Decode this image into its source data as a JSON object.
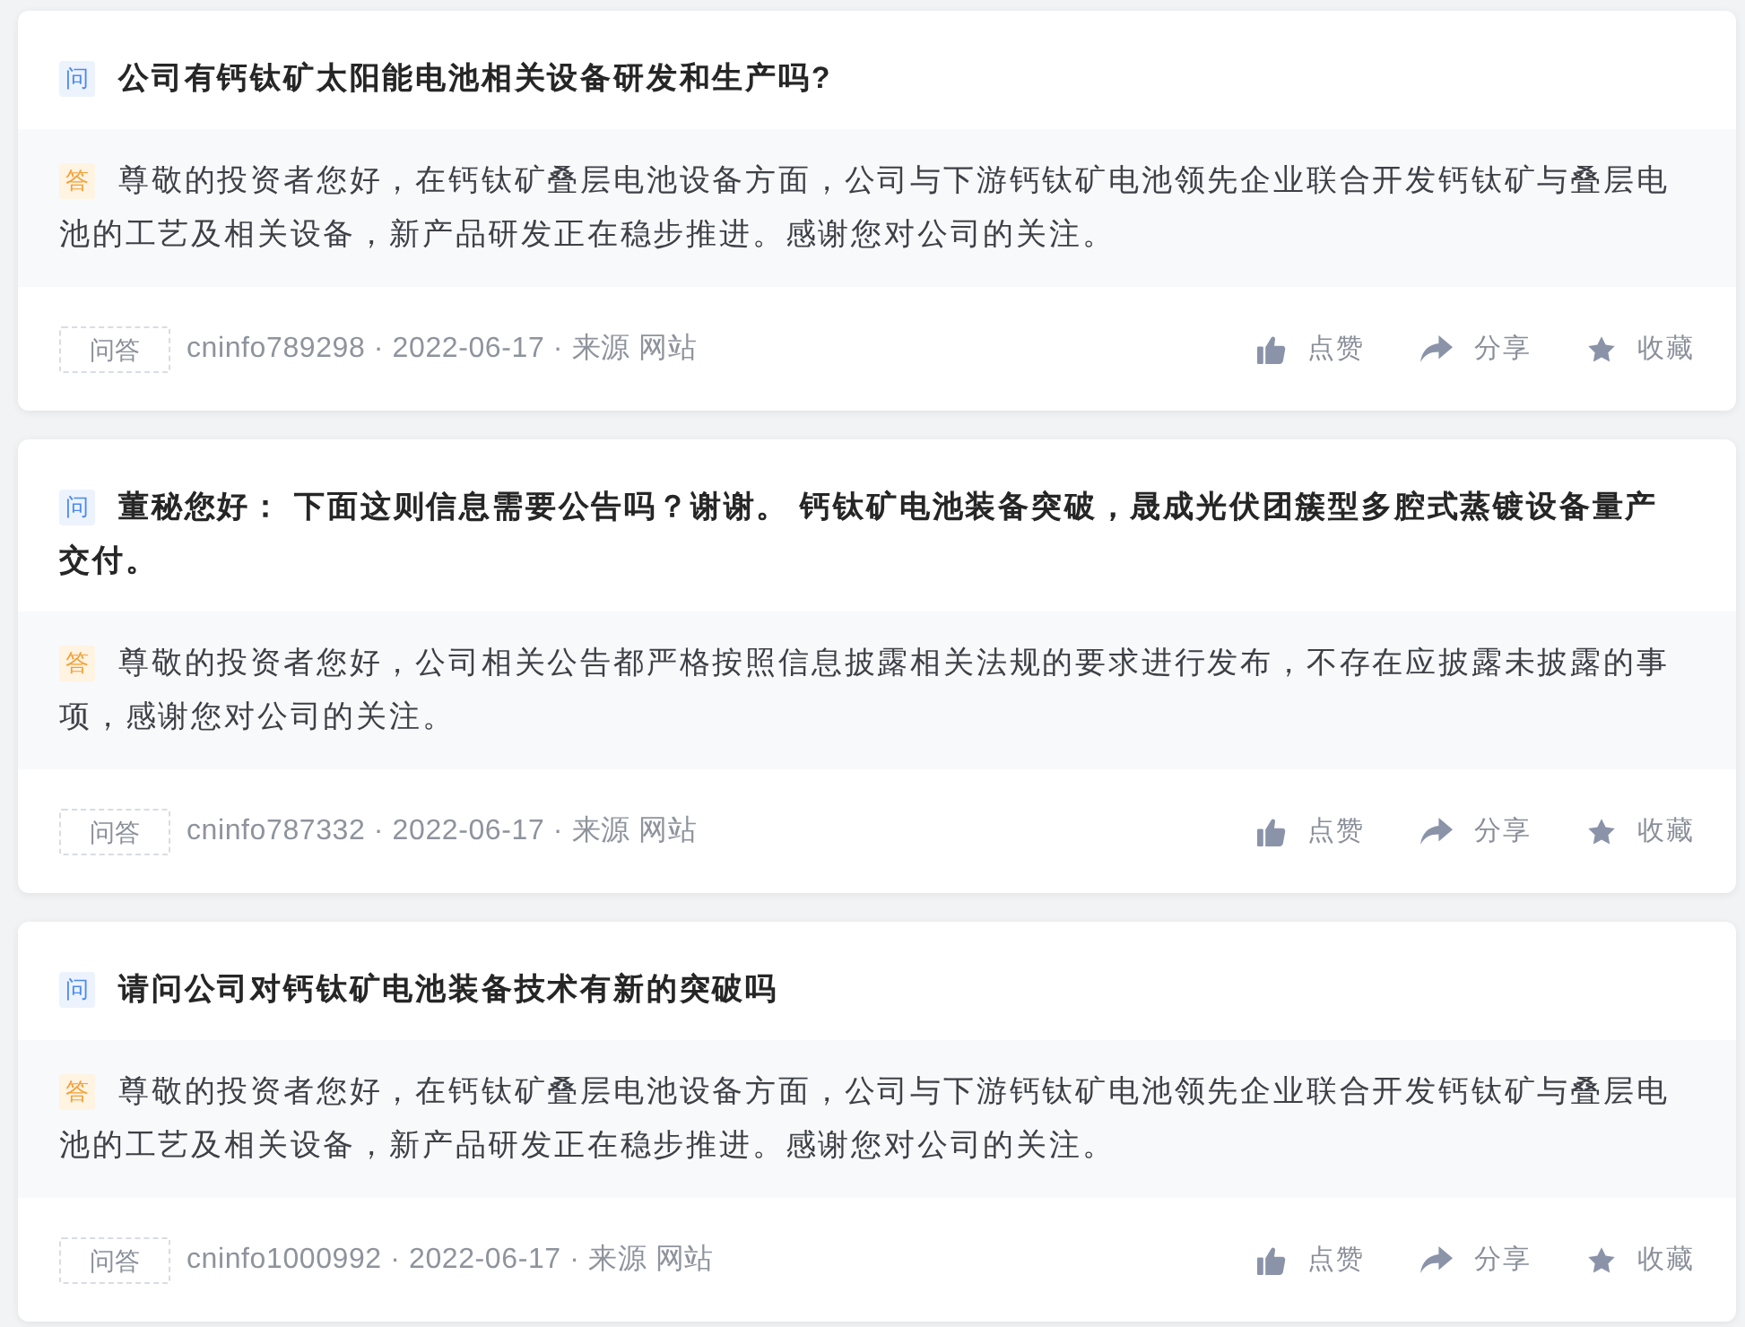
{
  "cards": [
    {
      "question": {
        "badge": "问",
        "text": "公司有钙钛矿太阳能电池相关设备研发和生产吗?"
      },
      "answer": {
        "badge": "答",
        "text": "尊敬的投资者您好，在钙钛矿叠层电池设备方面，公司与下游钙钛矿电池领先企业联合开发钙钛矿与叠层电池的工艺及相关设备，新产品研发正在稳步推进。感谢您对公司的关注。"
      },
      "tag": "问答",
      "meta": "cninfo789298 · 2022-06-17 · 来源 网站",
      "actions": [
        {
          "kind": "like",
          "label": "点赞"
        },
        {
          "kind": "share",
          "label": "分享"
        },
        {
          "kind": "favorite",
          "label": "收藏"
        }
      ]
    },
    {
      "question": {
        "badge": "问",
        "text": "董秘您好： 下面这则信息需要公告吗？谢谢。 钙钛矿电池装备突破，晟成光伏团簇型多腔式蒸镀设备量产交付。"
      },
      "answer": {
        "badge": "答",
        "text": "尊敬的投资者您好，公司相关公告都严格按照信息披露相关法规的要求进行发布，不存在应披露未披露的事项，感谢您对公司的关注。"
      },
      "tag": "问答",
      "meta": "cninfo787332 · 2022-06-17 · 来源 网站",
      "actions": [
        {
          "kind": "like",
          "label": "点赞"
        },
        {
          "kind": "share",
          "label": "分享"
        },
        {
          "kind": "favorite",
          "label": "收藏"
        }
      ]
    },
    {
      "question": {
        "badge": "问",
        "text": "请问公司对钙钛矿电池装备技术有新的突破吗"
      },
      "answer": {
        "badge": "答",
        "text": "尊敬的投资者您好，在钙钛矿叠层电池设备方面，公司与下游钙钛矿电池领先企业联合开发钙钛矿与叠层电池的工艺及相关设备，新产品研发正在稳步推进。感谢您对公司的关注。"
      },
      "tag": "问答",
      "meta": "cninfo1000992 · 2022-06-17 · 来源 网站",
      "actions": [
        {
          "kind": "like",
          "label": "点赞"
        },
        {
          "kind": "share",
          "label": "分享"
        },
        {
          "kind": "favorite",
          "label": "收藏"
        }
      ]
    }
  ]
}
